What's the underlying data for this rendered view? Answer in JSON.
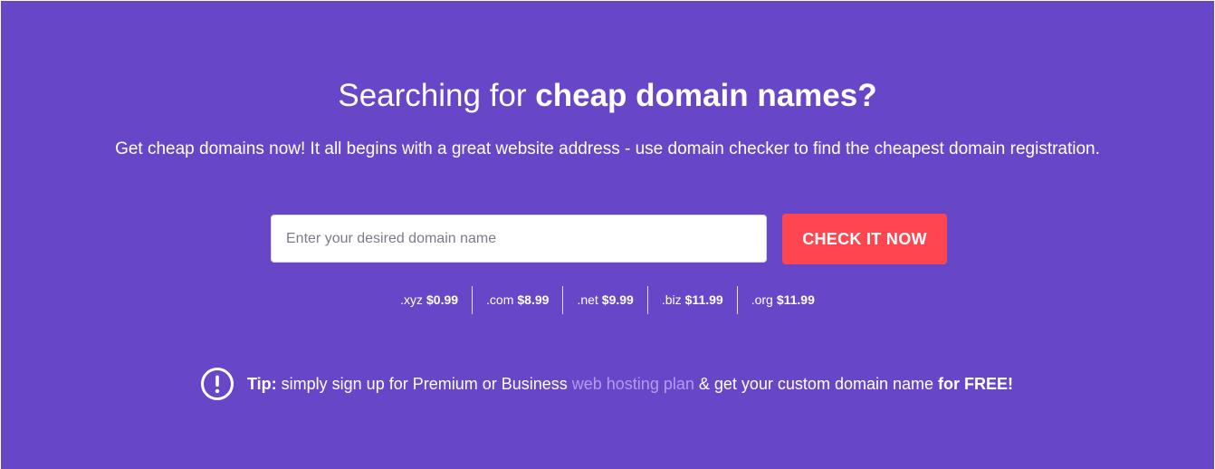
{
  "hero": {
    "title_regular": "Searching for ",
    "title_bold": "cheap domain names?",
    "subtitle": "Get cheap domains now! It all begins with a great website address - use domain checker to find the cheapest domain registration."
  },
  "search": {
    "placeholder": "Enter your desired domain name",
    "value": "",
    "button_label": "CHECK IT NOW"
  },
  "tlds": [
    {
      "ext": ".xyz",
      "price": "$0.99"
    },
    {
      "ext": ".com",
      "price": "$8.99"
    },
    {
      "ext": ".net",
      "price": "$9.99"
    },
    {
      "ext": ".biz",
      "price": "$11.99"
    },
    {
      "ext": ".org",
      "price": "$11.99"
    }
  ],
  "tip": {
    "icon": "exclamation-circle-icon",
    "label": "Tip:",
    "text_before_link": " simply sign up for Premium or Business ",
    "link_text": "web hosting plan",
    "text_after_link": " & get your custom domain name ",
    "bold_end": "for FREE!"
  },
  "colors": {
    "background": "#6747c7",
    "button": "#ff4650",
    "link": "#b39cf0",
    "text": "#ffffff"
  }
}
